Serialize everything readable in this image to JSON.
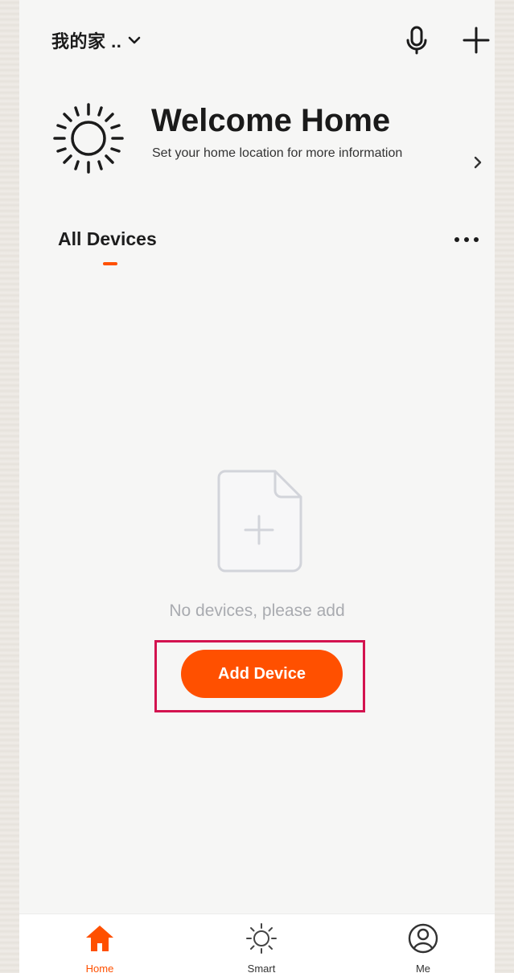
{
  "header": {
    "home_name": "我的家 ..",
    "dropdown_icon": "chevron-down-icon",
    "mic_icon": "microphone-icon",
    "add_icon": "plus-icon"
  },
  "welcome": {
    "icon": "sun-icon",
    "title": "Welcome Home",
    "subtitle": "Set your home location for more information"
  },
  "devices_section": {
    "tab_label": "All Devices",
    "more_icon": "more-dots-icon"
  },
  "empty_state": {
    "icon": "add-document-icon",
    "message": "No devices, please add",
    "button_label": "Add Device"
  },
  "bottom_nav": {
    "items": [
      {
        "label": "Home",
        "icon": "home-icon",
        "active": true
      },
      {
        "label": "Smart",
        "icon": "sun-outline-icon",
        "active": false
      },
      {
        "label": "Me",
        "icon": "user-circle-icon",
        "active": false
      }
    ]
  },
  "colors": {
    "accent": "#ff5000",
    "highlight_border": "#d3134f",
    "background": "#f6f6f5",
    "muted_text": "#a9abb0"
  }
}
